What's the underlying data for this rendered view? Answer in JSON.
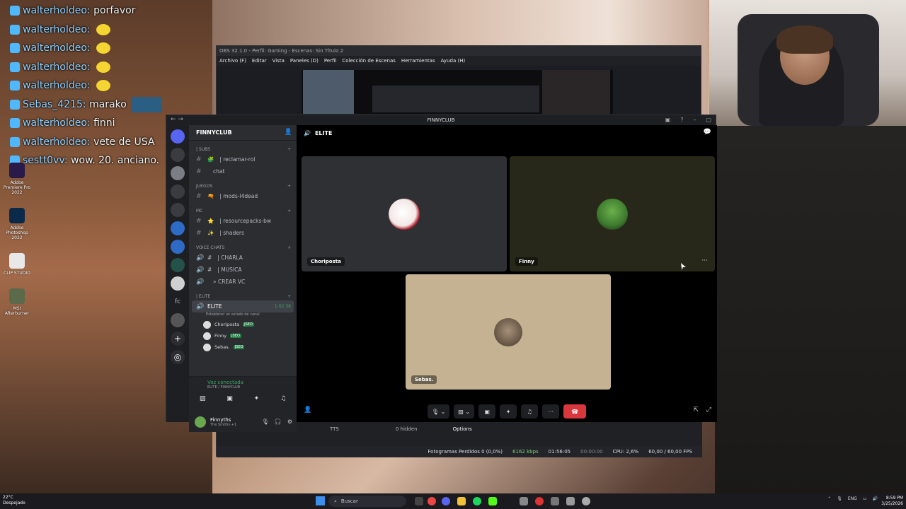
{
  "chat": [
    {
      "name": "walterholdeo:",
      "msg": "porfavor",
      "emoji": false,
      "emote": false
    },
    {
      "name": "walterholdeo:",
      "msg": "",
      "emoji": true,
      "emote": false
    },
    {
      "name": "walterholdeo:",
      "msg": "",
      "emoji": true,
      "emote": false
    },
    {
      "name": "walterholdeo:",
      "msg": "",
      "emoji": true,
      "emote": false
    },
    {
      "name": "walterholdeo:",
      "msg": "",
      "emoji": true,
      "emote": false
    },
    {
      "name": "Sebas_4215:",
      "msg": "marako",
      "emoji": false,
      "emote": true
    },
    {
      "name": "walterholdeo:",
      "msg": "finni",
      "emoji": false,
      "emote": false
    },
    {
      "name": "walterholdeo:",
      "msg": "vete de USA",
      "emoji": false,
      "emote": false
    },
    {
      "name": "sestt0vv:",
      "msg": "wow. 20. anciano.",
      "emoji": false,
      "emote": false
    }
  ],
  "desktop_icons": [
    {
      "label": "Adobe Premiere Pro 2022"
    },
    {
      "label": "Adobe Photoshop 2022"
    },
    {
      "label": "CLIP STUDIO"
    },
    {
      "label": "MSI Afterburner"
    }
  ],
  "obs": {
    "title": "OBS 32.1.0 - Perfil: Gaming - Escenas: Sin Título 2",
    "menu": [
      "Archivo (F)",
      "Editar",
      "Vista",
      "Paneles (D)",
      "Perfil",
      "Colección de Escenas",
      "Herramientas",
      "Ayuda (H)"
    ],
    "dock_tts": "TTS",
    "hidden": "0 hidden",
    "options": "Options",
    "status": {
      "frames": "Fotogramas Perdidos 0 (0,0%)",
      "kbps": "6162 kbps",
      "live": "01:56:05",
      "rec": "00:00:00",
      "cpu": "CPU: 2,6%",
      "fps": "60,00 / 60,00 FPS"
    }
  },
  "discord": {
    "window_title": "FINNYCLUB",
    "server_name": "FINNYCLUB",
    "categories": [
      {
        "name": "| SUBS",
        "channels": [
          {
            "icon": "#",
            "emoji": "🧩",
            "name": "| reclamar-rol"
          },
          {
            "icon": "#",
            "emoji": "",
            "name": "chat"
          }
        ]
      },
      {
        "name": "JUEGOS",
        "channels": [
          {
            "icon": "#",
            "emoji": "🔫",
            "name": "| mods-l4dead"
          }
        ]
      },
      {
        "name": "MC",
        "channels": [
          {
            "icon": "#",
            "emoji": "⭐",
            "name": "| resourcepacks-bw"
          },
          {
            "icon": "#",
            "emoji": "✨",
            "name": "| shaders"
          }
        ]
      },
      {
        "name": "VOICE CHATS",
        "channels": [
          {
            "icon": "🔊",
            "emoji": "#",
            "name": "| CHARLA"
          },
          {
            "icon": "🔊",
            "emoji": "#",
            "name": "| MUSICA"
          },
          {
            "icon": "🔊",
            "emoji": "",
            "name": "» CREAR VC"
          }
        ]
      }
    ],
    "elite_category": "| ELITE",
    "elite_channel": "ELITE",
    "elite_timer": "1:02:38",
    "elite_status": "Establecer un estado de canal",
    "members": [
      {
        "name": "Choriposta",
        "tag": "JSEO"
      },
      {
        "name": "Finny",
        "tag": "JSEO"
      },
      {
        "name": "Sebas.",
        "tag": "JSEO"
      }
    ],
    "voice": {
      "status": "Voz conectada",
      "location": "ELITE / FINNYCLUB"
    },
    "user": {
      "name": "Finnyths",
      "status": "The Smiths +1"
    },
    "call_title": "ELITE",
    "tiles": [
      {
        "name": "Choriposta"
      },
      {
        "name": "Finny"
      },
      {
        "name": "Sebas."
      }
    ]
  },
  "taskbar": {
    "weather_temp": "22°C",
    "weather_desc": "Despejado",
    "search": "Buscar",
    "lang": "ENG",
    "time": "8:59 PM",
    "date": "3/25/2026"
  }
}
